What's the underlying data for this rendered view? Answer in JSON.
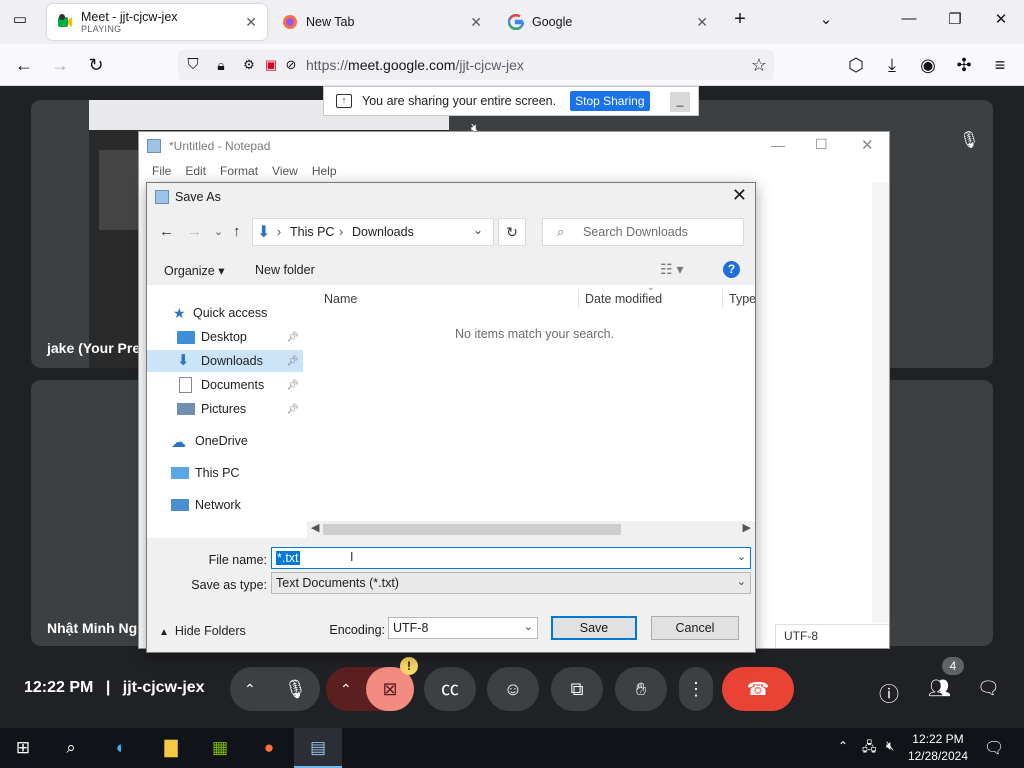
{
  "browser": {
    "tabs": [
      {
        "title": "Meet - jjt-cjcw-jex",
        "subtitle": "PLAYING",
        "active": true
      },
      {
        "title": "New Tab",
        "active": false
      },
      {
        "title": "Google",
        "active": false
      }
    ],
    "url": {
      "host": "meet.google.com",
      "path": "/jjt-cjcw-jex",
      "prefix": "https://"
    }
  },
  "share_bar": {
    "message": "You are sharing your entire screen.",
    "stop_label": "Stop Sharing"
  },
  "meet": {
    "participants": [
      {
        "name": "jake (Your Pre"
      },
      {
        "name": "Nhật Minh Ng"
      }
    ],
    "time": "12:22 PM",
    "separator": "|",
    "meeting_code": "jjt-cjcw-jex",
    "people_count": "4",
    "camera_warning": "!"
  },
  "notepad": {
    "title": "*Untitled - Notepad",
    "menu": [
      "File",
      "Edit",
      "Format",
      "View",
      "Help"
    ],
    "status_encoding": "UTF-8"
  },
  "save_as": {
    "title": "Save As",
    "breadcrumb": [
      "This PC",
      "Downloads"
    ],
    "search_placeholder": "Search Downloads",
    "organize_label": "Organize",
    "new_folder_label": "New folder",
    "nav": {
      "quick_access": "Quick access",
      "items": [
        "Desktop",
        "Downloads",
        "Documents",
        "Pictures"
      ],
      "onedrive": "OneDrive",
      "this_pc": "This PC",
      "network": "Network"
    },
    "columns": [
      "Name",
      "Date modified",
      "Type"
    ],
    "empty_message": "No items match your search.",
    "file_name_label": "File name:",
    "file_name_value": "*.txt",
    "save_type_label": "Save as type:",
    "save_type_value": "Text Documents (*.txt)",
    "hide_folders_label": "Hide Folders",
    "encoding_label": "Encoding:",
    "encoding_value": "UTF-8",
    "save_label": "Save",
    "cancel_label": "Cancel"
  },
  "taskbar": {
    "time": "12:22 PM",
    "date": "12/28/2024"
  }
}
